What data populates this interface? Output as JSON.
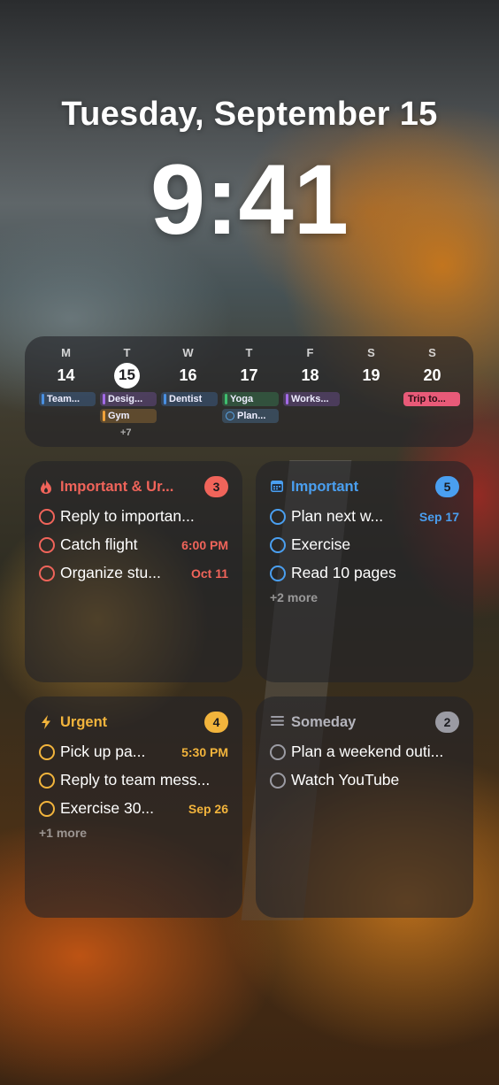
{
  "lock_screen": {
    "date": "Tuesday, September 15",
    "time": "9:41"
  },
  "calendar": {
    "days": [
      {
        "dow": "M",
        "num": "14",
        "today": false
      },
      {
        "dow": "T",
        "num": "15",
        "today": true
      },
      {
        "dow": "W",
        "num": "16",
        "today": false
      },
      {
        "dow": "T",
        "num": "17",
        "today": false
      },
      {
        "dow": "F",
        "num": "18",
        "today": false
      },
      {
        "dow": "S",
        "num": "19",
        "today": false
      },
      {
        "dow": "S",
        "num": "20",
        "today": false
      }
    ],
    "events": [
      {
        "label": "Team...",
        "color": "#4a90e2"
      },
      {
        "label": "Desig...",
        "color": "#a36be8"
      },
      {
        "label": "Gym",
        "color": "#f0a23a"
      },
      {
        "label": "Dentist",
        "color": "#4a90e2"
      },
      {
        "label": "Yoga",
        "color": "#3fbf6f"
      },
      {
        "label": "Plan...",
        "color": "#5aa5e6"
      },
      {
        "label": "Works...",
        "color": "#a36be8"
      },
      {
        "label": "Trip to...",
        "color": "#e85a78"
      }
    ],
    "more_label": "+7"
  },
  "widgets": {
    "important_urgent": {
      "icon": "flame-icon",
      "title": "Important & Ur...",
      "count": "3",
      "accent": "#f0645a",
      "tasks": [
        {
          "text": "Reply to importan...",
          "due": ""
        },
        {
          "text": "Catch flight",
          "due": "6:00 PM"
        },
        {
          "text": "Organize stu...",
          "due": "Oct 11"
        }
      ]
    },
    "important": {
      "icon": "calendar-icon",
      "title": "Important",
      "count": "5",
      "accent": "#4a9ff0",
      "tasks": [
        {
          "text": "Plan next w...",
          "due": "Sep 17"
        },
        {
          "text": "Exercise",
          "due": ""
        },
        {
          "text": "Read 10 pages",
          "due": ""
        }
      ],
      "more": "+2 more"
    },
    "urgent": {
      "icon": "lightning-icon",
      "title": "Urgent",
      "count": "4",
      "accent": "#f2b43c",
      "tasks": [
        {
          "text": "Pick up pa...",
          "due": "5:30 PM"
        },
        {
          "text": "Reply to team mess...",
          "due": ""
        },
        {
          "text": "Exercise 30...",
          "due": "Sep 26"
        }
      ],
      "more": "+1 more"
    },
    "someday": {
      "icon": "list-icon",
      "title": "Someday",
      "count": "2",
      "accent": "#9b9ba3",
      "tasks": [
        {
          "text": "Plan a weekend outi...",
          "due": ""
        },
        {
          "text": "Watch YouTube",
          "due": ""
        }
      ]
    }
  }
}
